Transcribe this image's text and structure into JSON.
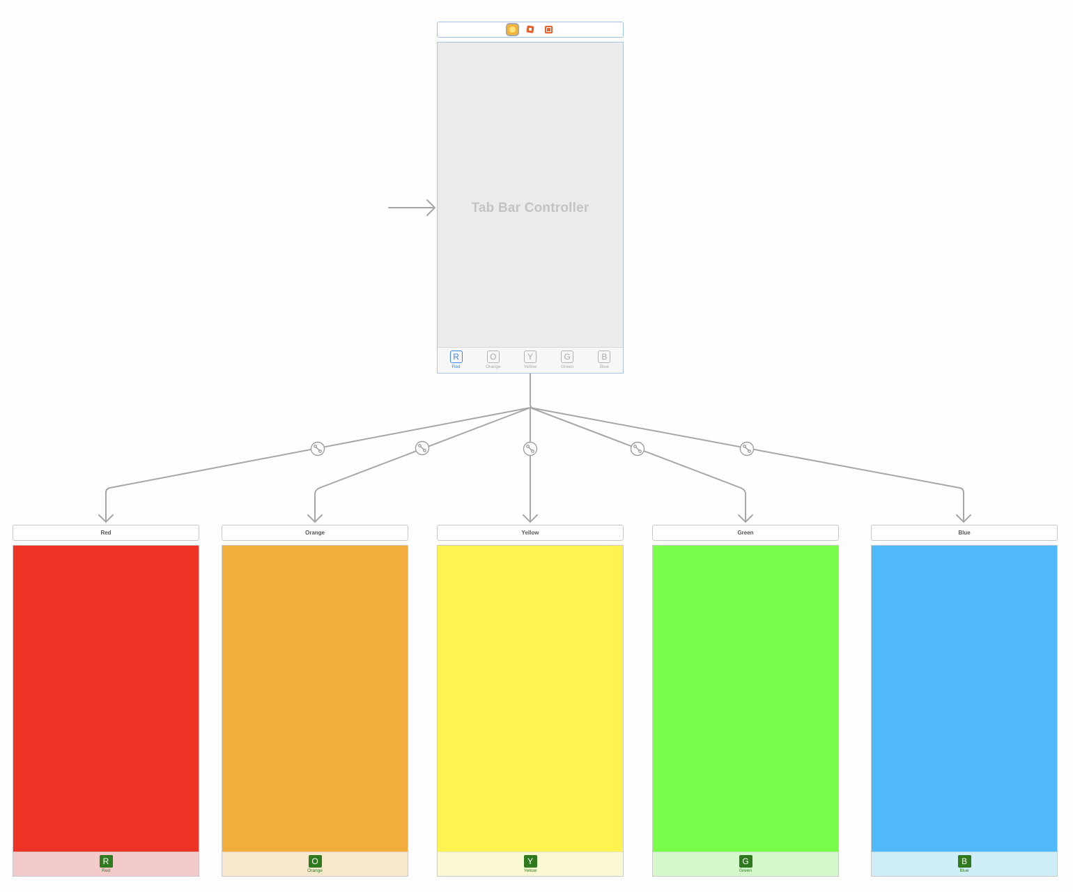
{
  "tab_bar_controller": {
    "title": "Tab Bar Controller",
    "dock_icons": [
      "view-controller-icon",
      "first-responder-icon",
      "exit-icon"
    ],
    "tabs": [
      {
        "glyph": "R",
        "label": "Red",
        "selected": true
      },
      {
        "glyph": "O",
        "label": "Orange",
        "selected": false
      },
      {
        "glyph": "Y",
        "label": "Yellow",
        "selected": false
      },
      {
        "glyph": "G",
        "label": "Green",
        "selected": false
      },
      {
        "glyph": "B",
        "label": "Blue",
        "selected": false
      }
    ],
    "selected_tab_color": "#3b87f2"
  },
  "scenes": [
    {
      "title": "Red",
      "glyph": "R",
      "tab_label": "Red",
      "color": "#ee3324",
      "tabbar_color": "#f2caca"
    },
    {
      "title": "Orange",
      "glyph": "O",
      "tab_label": "Orange",
      "color": "#f1ae3d",
      "tabbar_color": "#f6e8cc"
    },
    {
      "title": "Yellow",
      "glyph": "Y",
      "tab_label": "Yellow",
      "color": "#fff350",
      "tabbar_color": "#fbf9d4"
    },
    {
      "title": "Green",
      "glyph": "G",
      "tab_label": "Green",
      "color": "#78fe4a",
      "tabbar_color": "#d4f8cc"
    },
    {
      "title": "Blue",
      "glyph": "B",
      "tab_label": "Blue",
      "color": "#50b9fa",
      "tabbar_color": "#d0eef8"
    }
  ],
  "colors": {
    "badge": "#2f7a1f",
    "segue_line": "#a0a0a0"
  }
}
